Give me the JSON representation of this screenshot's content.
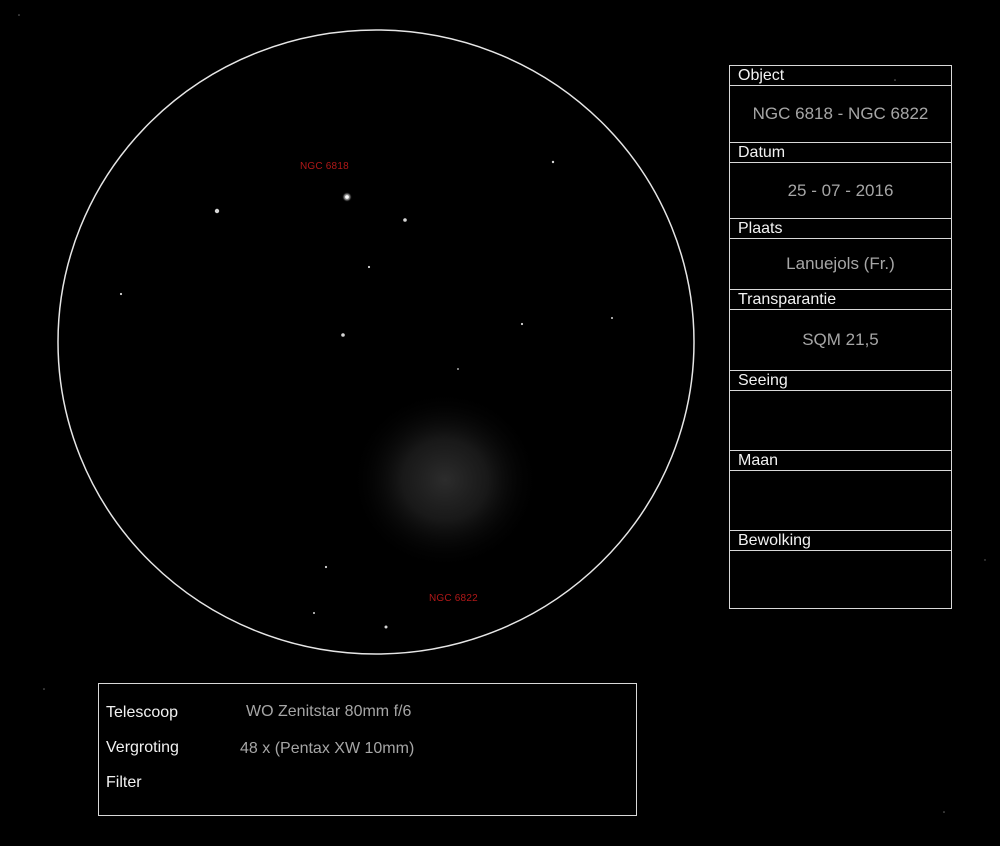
{
  "field": {
    "labels": {
      "object_a": "NGC 6818",
      "object_b": "NGC 6822"
    }
  },
  "observation": {
    "object": {
      "label": "Object",
      "value": "NGC 6818 - NGC 6822"
    },
    "date": {
      "label": "Datum",
      "value": "25 - 07 - 2016"
    },
    "location": {
      "label": "Plaats",
      "value": "Lanuejols (Fr.)"
    },
    "transparency": {
      "label": "Transparantie",
      "value": "SQM 21,5"
    },
    "seeing": {
      "label": "Seeing",
      "value": ""
    },
    "moon": {
      "label": "Maan",
      "value": ""
    },
    "clouds": {
      "label": "Bewolking",
      "value": ""
    }
  },
  "equipment": {
    "telescope": {
      "label": "Telescoop",
      "value": "WO Zenitstar 80mm f/6"
    },
    "magnification": {
      "label": "Vergroting",
      "value": "48 x (Pentax XW 10mm)"
    },
    "filter": {
      "label": "Filter",
      "value": ""
    }
  },
  "colors": {
    "background": "#000000",
    "lines": "#d8d8d8",
    "object_label": "#b01818",
    "header_text": "#f2f2f2",
    "value_text": "#a6a6a6"
  }
}
